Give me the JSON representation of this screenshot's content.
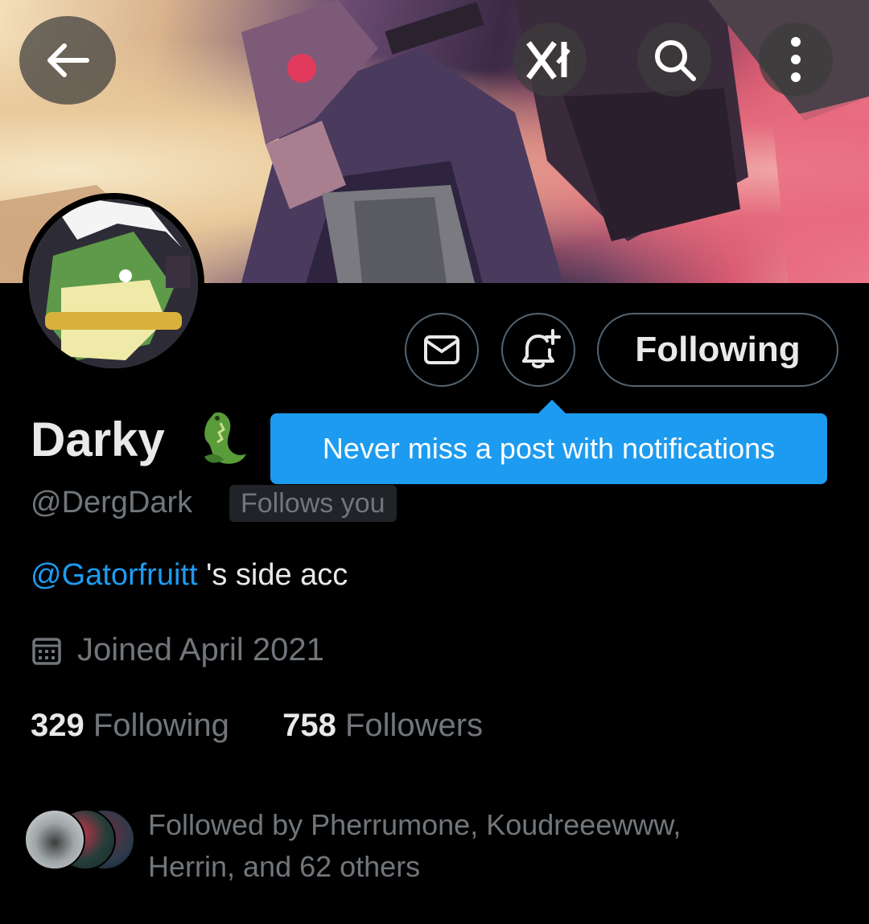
{
  "topbar": {
    "back_icon": "arrow-left-icon",
    "grok_icon": "grok-icon",
    "search_icon": "search-icon",
    "more_icon": "more-vertical-icon"
  },
  "profile": {
    "display_name": "Darky",
    "name_emoji": "crocodile-emoji",
    "handle": "@DergDark",
    "follows_you": "Follows you",
    "bio_mention": "@Gatorfruitt",
    "bio_text": " 's side acc",
    "joined": "Joined April 2021",
    "following_count": "329",
    "following_label": "Following",
    "followers_count": "758",
    "followers_label": "Followers",
    "followed_by_line1": "Followed by Pherrumone, Koudreeewww,",
    "followed_by_line2": "Herrin, and 62 others"
  },
  "actions": {
    "message_icon": "envelope-icon",
    "notify_icon": "bell-plus-icon",
    "follow_button": "Following"
  },
  "tooltip": {
    "text": "Never miss a post with notifications"
  },
  "colors": {
    "accent": "#1d9bf0",
    "background": "#000000",
    "muted": "#71767b",
    "border": "#536471"
  }
}
